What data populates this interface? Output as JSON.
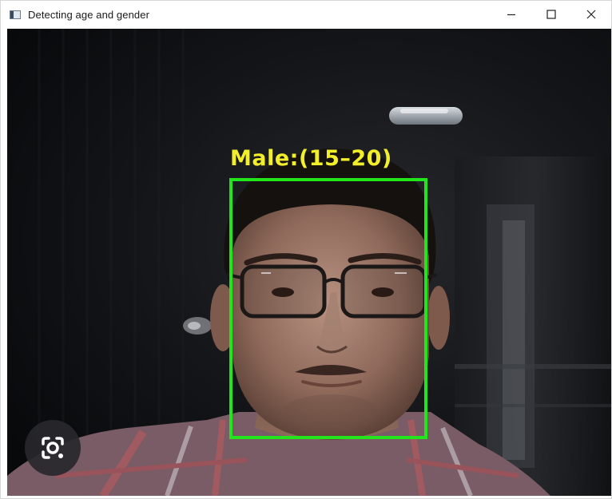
{
  "window": {
    "title": "Detecting age and gender",
    "icons": {
      "app": "window-app-icon",
      "minimize": "minimize-icon",
      "maximize": "maximize-icon",
      "close": "close-icon"
    }
  },
  "detection": {
    "label": "Male:(15–20)",
    "box_color": "#22e51c",
    "label_color": "#f2ee2a"
  },
  "overlay": {
    "lens_button_icon": "camera-lens-icon"
  }
}
